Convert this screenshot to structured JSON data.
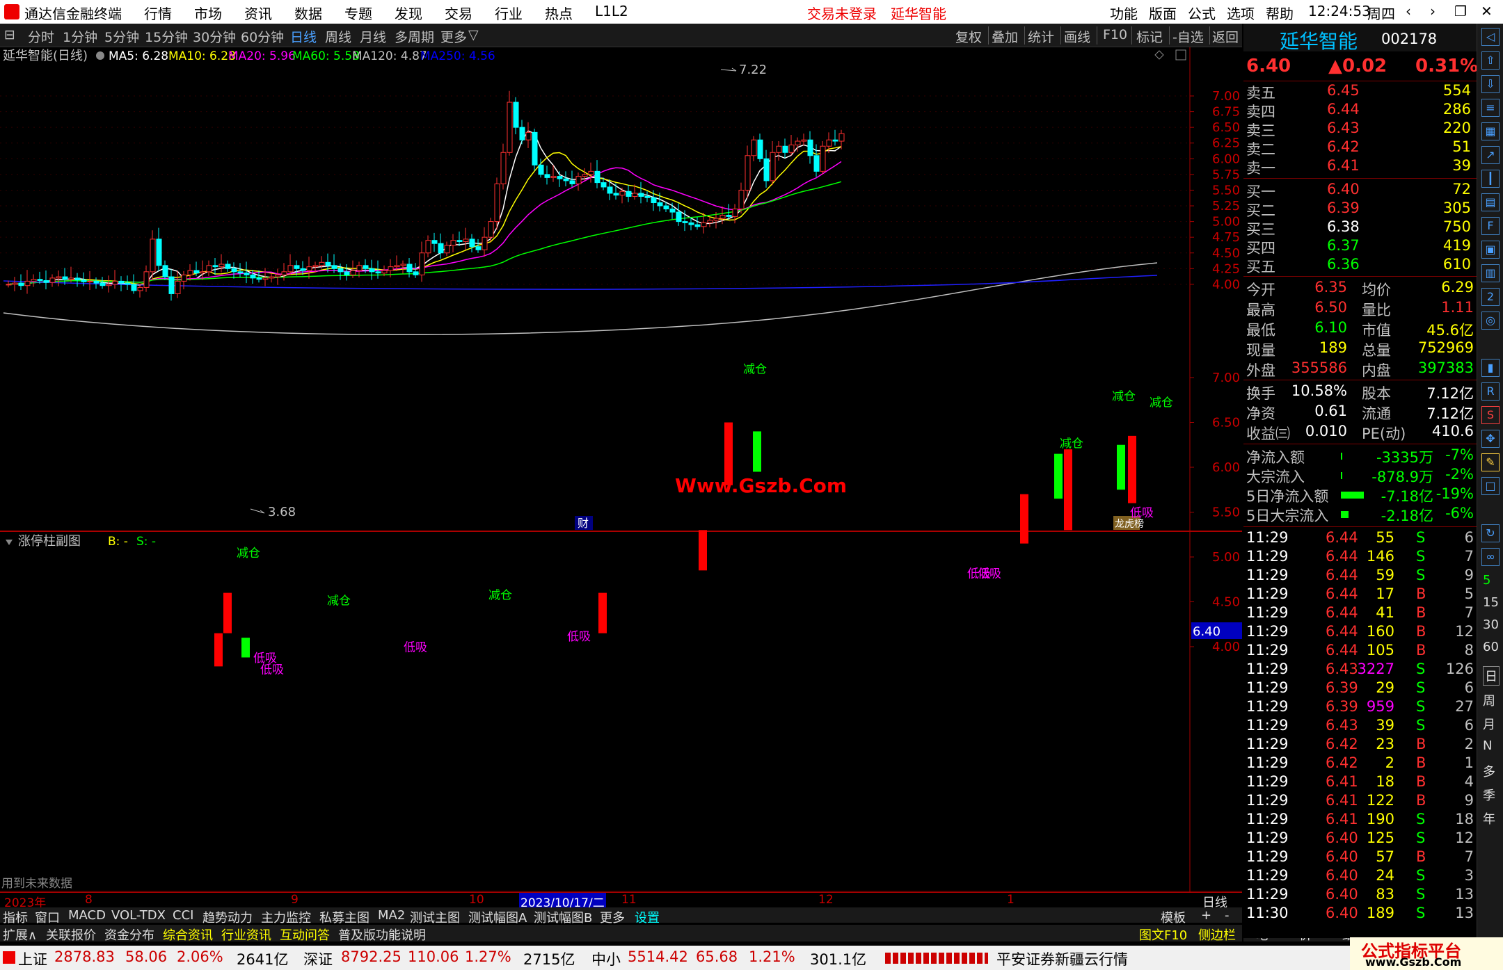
{
  "app": {
    "title": "通达信金融终端",
    "menus": [
      "行情",
      "市场",
      "资讯",
      "数据",
      "专题",
      "发现",
      "交易",
      "行业",
      "热点",
      "L1L2"
    ],
    "login_status": "交易未登录",
    "stock_title": "延华智能",
    "right_menus": [
      "功能",
      "版面",
      "公式",
      "选项",
      "帮助"
    ],
    "time": "12:24:53",
    "weekday": "周四"
  },
  "toolbar": {
    "timeframes": [
      "分时",
      "1分钟",
      "5分钟",
      "15分钟",
      "30分钟",
      "60分钟",
      "日线",
      "周线",
      "月线",
      "多周期",
      "更多"
    ],
    "active": "日线",
    "buttons": [
      "复权",
      "叠加",
      "统计",
      "画线",
      "F10",
      "标记",
      "-自选",
      "返回"
    ]
  },
  "main_chart": {
    "title": "延华智能(日线)",
    "ma": [
      {
        "label": "MA5: 6.28",
        "color": "#ffffff"
      },
      {
        "label": "MA10: 6.28",
        "color": "#ffff00"
      },
      {
        "label": "MA20: 5.96",
        "color": "#ff00ff"
      },
      {
        "label": "MA60: 5.58",
        "color": "#00ff00"
      },
      {
        "label": "MA120: 4.87",
        "color": "#c0c0c0"
      },
      {
        "label": "MA250: 4.56",
        "color": "#0000ff"
      }
    ],
    "high_label": "7.22",
    "low_label": "3.68",
    "watermark": "Www.Gszb.Com",
    "badge_cai": "财",
    "badge_longhu": "龙虎榜",
    "price_axis": [
      "7.00",
      "6.75",
      "6.50",
      "6.25",
      "6.00",
      "5.75",
      "5.50",
      "5.25",
      "5.00",
      "4.75",
      "4.50",
      "4.25",
      "4.00"
    ]
  },
  "sub_chart": {
    "title": "涨停柱副图",
    "b_label": "B: -",
    "s_label": "S: -",
    "future_note": "用到未来数据",
    "price_axis": [
      "7.00",
      "6.50",
      "6.00",
      "5.50",
      "5.00",
      "4.50",
      "4.00"
    ],
    "current_price": "6.40",
    "signal_reduce": "减仓",
    "signal_low_buy": "低吸"
  },
  "x_axis": {
    "labels": [
      "2023年",
      "8",
      "9",
      "10",
      "2023/10/17/二",
      "11",
      "12",
      "1"
    ],
    "period": "日线"
  },
  "bottom_tabs": [
    "指标",
    "窗口",
    "MACD",
    "VOL-TDX",
    "CCI",
    "趋势动力",
    "主力监控",
    "私募主图",
    "MA2",
    "测试主图",
    "测试幅图A",
    "测试幅图B",
    "更多",
    "设置"
  ],
  "bottom_right": [
    "模板",
    "+",
    "-"
  ],
  "bottom_tabs2": [
    "扩展∧",
    "关联报价",
    "资金分布",
    "综合资讯",
    "行业资讯",
    "互动问答",
    "普及版功能说明"
  ],
  "bottom_tabs2_right": [
    "图文F10",
    "侧边栏《",
    "笔",
    "价",
    "细",
    "势"
  ],
  "quote": {
    "name": "延华智能",
    "code": "002178",
    "price": "6.40",
    "change": "▲0.02",
    "pct": "0.31%",
    "asks": [
      {
        "label": "卖五",
        "price": "6.45",
        "vol": "554"
      },
      {
        "label": "卖四",
        "price": "6.44",
        "vol": "286"
      },
      {
        "label": "卖三",
        "price": "6.43",
        "vol": "220"
      },
      {
        "label": "卖二",
        "price": "6.42",
        "vol": "51"
      },
      {
        "label": "卖一",
        "price": "6.41",
        "vol": "39"
      }
    ],
    "bids": [
      {
        "label": "买一",
        "price": "6.40",
        "vol": "72"
      },
      {
        "label": "买二",
        "price": "6.39",
        "vol": "305"
      },
      {
        "label": "买三",
        "price": "6.38",
        "vol": "750"
      },
      {
        "label": "买四",
        "price": "6.37",
        "vol": "419"
      },
      {
        "label": "买五",
        "price": "6.36",
        "vol": "610"
      }
    ],
    "stats": [
      [
        "今开",
        "6.35",
        "均价",
        "6.29"
      ],
      [
        "最高",
        "6.50",
        "量比",
        "1.11"
      ],
      [
        "最低",
        "6.10",
        "市值",
        "45.6亿"
      ],
      [
        "现量",
        "189",
        "总量",
        "752969"
      ],
      [
        "外盘",
        "355586",
        "内盘",
        "397383"
      ]
    ],
    "stats2": [
      [
        "换手",
        "10.58%",
        "股本",
        "7.12亿"
      ],
      [
        "净资",
        "0.61",
        "流通",
        "7.12亿"
      ],
      [
        "收益㈢",
        "0.010",
        "PE(动)",
        "410.6"
      ]
    ],
    "flows": [
      {
        "label": "净流入额",
        "value": "-3335万",
        "pct": "-7%",
        "bar": 0.02
      },
      {
        "label": "大宗流入",
        "value": "-878.9万",
        "pct": "-2%",
        "bar": 0.02
      },
      {
        "label": "5日净流入额",
        "value": "-7.18亿",
        "pct": "-19%",
        "bar": 0.6
      },
      {
        "label": "5日大宗流入",
        "value": "-2.18亿",
        "pct": "-6%",
        "bar": 0.2
      }
    ],
    "ticks": [
      [
        "11:29",
        "6.44",
        "55",
        "S",
        "6"
      ],
      [
        "11:29",
        "6.44",
        "146",
        "S",
        "7"
      ],
      [
        "11:29",
        "6.44",
        "59",
        "S",
        "9"
      ],
      [
        "11:29",
        "6.44",
        "17",
        "B",
        "5"
      ],
      [
        "11:29",
        "6.44",
        "41",
        "B",
        "7"
      ],
      [
        "11:29",
        "6.44",
        "160",
        "B",
        "12"
      ],
      [
        "11:29",
        "6.44",
        "105",
        "B",
        "8"
      ],
      [
        "11:29",
        "6.43",
        "3227",
        "S",
        "126"
      ],
      [
        "11:29",
        "6.39",
        "29",
        "S",
        "6"
      ],
      [
        "11:29",
        "6.39",
        "959",
        "S",
        "27"
      ],
      [
        "11:29",
        "6.43",
        "39",
        "S",
        "6"
      ],
      [
        "11:29",
        "6.42",
        "23",
        "B",
        "2"
      ],
      [
        "11:29",
        "6.42",
        "2",
        "B",
        "1"
      ],
      [
        "11:29",
        "6.41",
        "18",
        "B",
        "4"
      ],
      [
        "11:29",
        "6.41",
        "122",
        "B",
        "9"
      ],
      [
        "11:29",
        "6.41",
        "190",
        "S",
        "18"
      ],
      [
        "11:29",
        "6.40",
        "125",
        "S",
        "12"
      ],
      [
        "11:29",
        "6.40",
        "57",
        "B",
        "7"
      ],
      [
        "11:29",
        "6.40",
        "24",
        "S",
        "3"
      ],
      [
        "11:29",
        "6.40",
        "83",
        "S",
        "13"
      ],
      [
        "11:30",
        "6.40",
        "189",
        "S",
        "13"
      ]
    ]
  },
  "right_toolbar": [
    "日",
    "周",
    "月",
    "N",
    "多",
    "季",
    "年"
  ],
  "status": {
    "sh_label": "上证",
    "sh_val": "2878.83",
    "sh_chg": "58.06",
    "sh_pct": "2.06%",
    "sh_amt": "2641亿",
    "sz_label": "深证",
    "sz_val": "8792.25",
    "sz_chg": "110.06",
    "sz_pct": "1.27%",
    "sz_amt": "2715亿",
    "zx_label": "中小",
    "zx_val": "5514.42",
    "zx_chg": "65.68",
    "zx_pct": "1.21%",
    "zx_amt": "301.1亿",
    "broker": "平安证券新疆云行情",
    "brand": "公式指标平台",
    "brand_url": "www.Gszb.Com"
  }
}
